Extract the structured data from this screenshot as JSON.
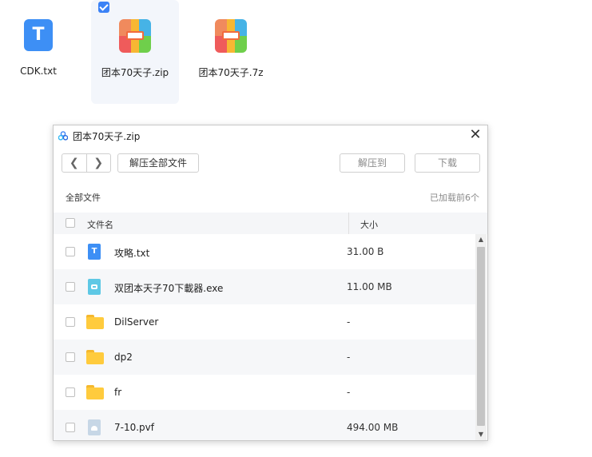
{
  "desktop": {
    "files": [
      {
        "name": "CDK.txt",
        "icon": "txt-file-icon"
      },
      {
        "name": "团本70天子.zip",
        "icon": "zip-archive-icon",
        "selected": true
      },
      {
        "name": "团本70天子.7z",
        "icon": "zip-archive-icon"
      }
    ]
  },
  "dialog": {
    "title": "团本70天子.zip",
    "toolbar": {
      "back": "❮",
      "forward": "❯",
      "extract_all": "解压全部文件",
      "extract_to": "解压到",
      "download": "下载"
    },
    "path": "全部文件",
    "status": "已加载前6个",
    "columns": {
      "name": "文件名",
      "size": "大小"
    },
    "rows": [
      {
        "name": "攻略.txt",
        "size": "31.00 B",
        "icon": "txt-file-icon"
      },
      {
        "name": "双团本天子70下載器.exe",
        "size": "11.00 MB",
        "icon": "exe-file-icon"
      },
      {
        "name": "DilServer",
        "size": "-",
        "icon": "folder-icon"
      },
      {
        "name": "dp2",
        "size": "-",
        "icon": "folder-icon"
      },
      {
        "name": "fr",
        "size": "-",
        "icon": "folder-icon"
      },
      {
        "name": "7-10.pvf",
        "size": "494.00 MB",
        "icon": "pvf-file-icon"
      }
    ]
  },
  "colors": {
    "accent": "#3b82f6",
    "folder": "#ffcb3d",
    "row_alt": "#f6f7f9",
    "header_bg": "#f5f6f8"
  }
}
